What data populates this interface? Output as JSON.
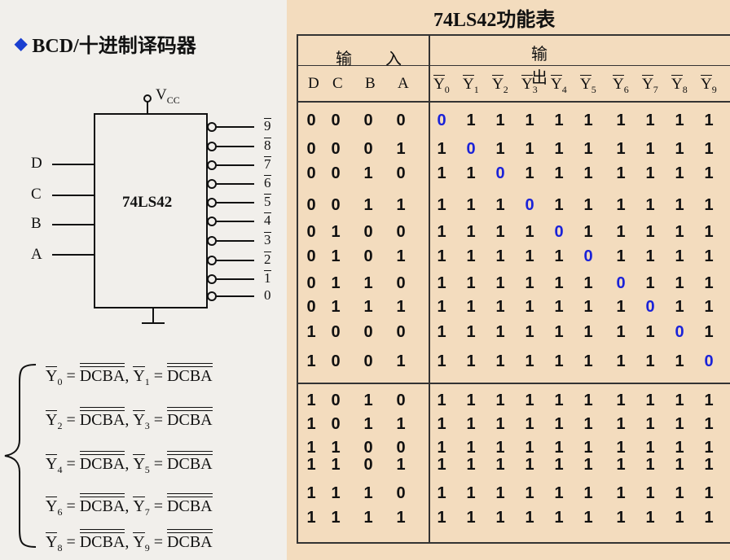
{
  "left_panel": {
    "title": "BCD/十进制译码器",
    "vcc_label": "V",
    "vcc_sub": "CC",
    "chip_label": "74LS42",
    "inputs": [
      "D",
      "C",
      "B",
      "A"
    ],
    "outputs": [
      "9",
      "8",
      "7",
      "6",
      "5",
      "4",
      "3",
      "2",
      "1",
      "0"
    ],
    "equations": [
      {
        "l1": "Y",
        "s1": "0",
        "r1": "DCBA",
        "l2": "Y",
        "s2": "1",
        "r2": "DCBA"
      },
      {
        "l1": "Y",
        "s1": "2",
        "r1": "DCBA",
        "l2": "Y",
        "s2": "3",
        "r2": "DCBA"
      },
      {
        "l1": "Y",
        "s1": "4",
        "r1": "DCBA",
        "l2": "Y",
        "s2": "5",
        "r2": "DCBA"
      },
      {
        "l1": "Y",
        "s1": "6",
        "r1": "DCBA",
        "l2": "Y",
        "s2": "7",
        "r2": "DCBA"
      },
      {
        "l1": "Y",
        "s1": "8",
        "r1": "DCBA",
        "l2": "Y",
        "s2": "9",
        "r2": "DCBA"
      }
    ]
  },
  "truth_table": {
    "title": "74LS42功能表",
    "input_header": "输 入",
    "output_header": "输 出",
    "input_cols": [
      "D",
      "C",
      "B",
      "A"
    ],
    "output_cols": [
      "0",
      "1",
      "2",
      "3",
      "4",
      "5",
      "6",
      "7",
      "8",
      "9"
    ],
    "output_col_letter": "Y",
    "rows": [
      [
        "0",
        "0",
        "0",
        "0",
        "0",
        "1",
        "1",
        "1",
        "1",
        "1",
        "1",
        "1",
        "1",
        "1"
      ],
      [
        "0",
        "0",
        "0",
        "1",
        "1",
        "0",
        "1",
        "1",
        "1",
        "1",
        "1",
        "1",
        "1",
        "1"
      ],
      [
        "0",
        "0",
        "1",
        "0",
        "1",
        "1",
        "0",
        "1",
        "1",
        "1",
        "1",
        "1",
        "1",
        "1"
      ],
      [
        "0",
        "0",
        "1",
        "1",
        "1",
        "1",
        "1",
        "0",
        "1",
        "1",
        "1",
        "1",
        "1",
        "1"
      ],
      [
        "0",
        "1",
        "0",
        "0",
        "1",
        "1",
        "1",
        "1",
        "0",
        "1",
        "1",
        "1",
        "1",
        "1"
      ],
      [
        "0",
        "1",
        "0",
        "1",
        "1",
        "1",
        "1",
        "1",
        "1",
        "0",
        "1",
        "1",
        "1",
        "1"
      ],
      [
        "0",
        "1",
        "1",
        "0",
        "1",
        "1",
        "1",
        "1",
        "1",
        "1",
        "0",
        "1",
        "1",
        "1"
      ],
      [
        "0",
        "1",
        "1",
        "1",
        "1",
        "1",
        "1",
        "1",
        "1",
        "1",
        "1",
        "0",
        "1",
        "1"
      ],
      [
        "1",
        "0",
        "0",
        "0",
        "1",
        "1",
        "1",
        "1",
        "1",
        "1",
        "1",
        "1",
        "0",
        "1"
      ],
      [
        "1",
        "0",
        "0",
        "1",
        "1",
        "1",
        "1",
        "1",
        "1",
        "1",
        "1",
        "1",
        "1",
        "0"
      ],
      [
        "1",
        "0",
        "1",
        "0",
        "1",
        "1",
        "1",
        "1",
        "1",
        "1",
        "1",
        "1",
        "1",
        "1"
      ],
      [
        "1",
        "0",
        "1",
        "1",
        "1",
        "1",
        "1",
        "1",
        "1",
        "1",
        "1",
        "1",
        "1",
        "1"
      ],
      [
        "1",
        "1",
        "0",
        "0",
        "1",
        "1",
        "1",
        "1",
        "1",
        "1",
        "1",
        "1",
        "1",
        "1"
      ],
      [
        "1",
        "1",
        "0",
        "1",
        "1",
        "1",
        "1",
        "1",
        "1",
        "1",
        "1",
        "1",
        "1",
        "1"
      ],
      [
        "1",
        "1",
        "1",
        "0",
        "1",
        "1",
        "1",
        "1",
        "1",
        "1",
        "1",
        "1",
        "1",
        "1"
      ],
      [
        "1",
        "1",
        "1",
        "1",
        "1",
        "1",
        "1",
        "1",
        "1",
        "1",
        "1",
        "1",
        "1",
        "1"
      ]
    ],
    "highlight_color": "#1a22d8"
  }
}
